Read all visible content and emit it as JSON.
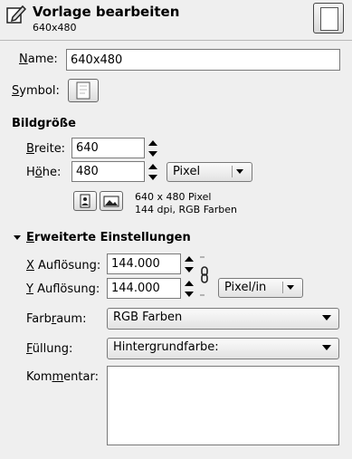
{
  "header": {
    "title": "Vorlage bearbeiten",
    "subtitle": "640x480"
  },
  "name": {
    "label_pre": "",
    "label_mn": "N",
    "label_post": "ame:",
    "value": "640x480"
  },
  "symbol": {
    "label_mn": "S",
    "label_post": "ymbol:"
  },
  "size_section": {
    "title": "Bildgröße",
    "width_label_mn": "B",
    "width_label_post": "reite:",
    "width_value": "640",
    "height_label_pre": "H",
    "height_label_mn": "ö",
    "height_label_post": "he:",
    "unit": "Pixel",
    "info_line1": "640 x 480 Pixel",
    "info_line2": "144 dpi, RGB Farben"
  },
  "advanced": {
    "title_mn": "E",
    "title_post": "rweiterte Einstellungen",
    "xres_label_mn": "X",
    "xres_label_post": " Auflösung:",
    "xres_value": "144.000",
    "yres_label_mn": "Y",
    "yres_label_post": " Auflösung:",
    "yres_value": "144.000",
    "res_unit": "Pixel/in",
    "colorspace_label_pre": "Farb",
    "colorspace_label_mn": "r",
    "colorspace_label_post": "aum:",
    "colorspace_value": "RGB Farben",
    "fill_label_mn": "F",
    "fill_label_post": "üllung:",
    "fill_value": "Hintergrundfarbe:",
    "comment_label_pre": "Kom",
    "comment_label_mn": "m",
    "comment_label_post": "entar:",
    "comment_value": ""
  }
}
